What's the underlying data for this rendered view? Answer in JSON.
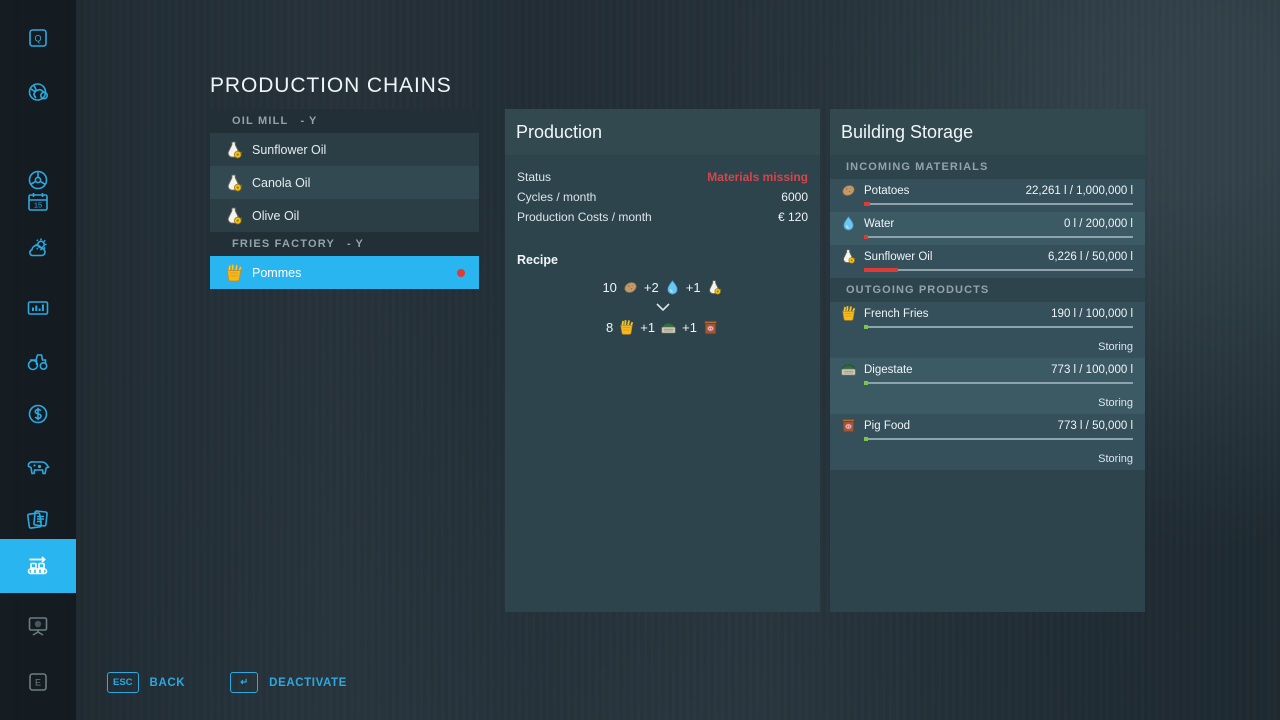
{
  "page_title": "PRODUCTION CHAINS",
  "sidebar": {
    "items": [
      {
        "name": "quick-menu",
        "icon": "q-key-icon",
        "active": false,
        "dim": false
      },
      {
        "name": "map",
        "icon": "globe-icon",
        "active": false,
        "dim": false
      },
      {
        "name": "vehicles-steering",
        "icon": "steering-wheel-icon",
        "active": false,
        "dim": false
      },
      {
        "name": "calendar",
        "icon": "calendar-15-icon",
        "active": false,
        "dim": false
      },
      {
        "name": "weather",
        "icon": "sun-cloud-icon",
        "active": false,
        "dim": false
      },
      {
        "name": "statistics",
        "icon": "bar-chart-icon",
        "active": false,
        "dim": false
      },
      {
        "name": "vehicles",
        "icon": "tractor-icon",
        "active": false,
        "dim": false
      },
      {
        "name": "finances",
        "icon": "dollar-circle-icon",
        "active": false,
        "dim": false
      },
      {
        "name": "animals",
        "icon": "cow-icon",
        "active": false,
        "dim": false
      },
      {
        "name": "contracts",
        "icon": "documents-icon",
        "active": false,
        "dim": false
      },
      {
        "name": "production",
        "icon": "conveyor-belt-icon",
        "active": true,
        "dim": false
      },
      {
        "name": "gallery",
        "icon": "easel-icon",
        "active": false,
        "dim": true
      },
      {
        "name": "exit",
        "icon": "e-key-icon",
        "active": false,
        "dim": true
      }
    ],
    "calendar_day": "15",
    "quick_key": "Q",
    "exit_key": "E"
  },
  "chains": {
    "groups": [
      {
        "header": "OIL MILL",
        "hotkey": "-  Y",
        "items": [
          {
            "label": "Sunflower Oil",
            "icon": "oil-bottle-icon",
            "selected": false,
            "status_dot": null
          },
          {
            "label": "Canola Oil",
            "icon": "oil-bottle-icon",
            "selected": false,
            "status_dot": null
          },
          {
            "label": "Olive Oil",
            "icon": "oil-bottle-icon",
            "selected": false,
            "status_dot": null
          }
        ]
      },
      {
        "header": "FRIES FACTORY",
        "hotkey": "-  Y",
        "items": [
          {
            "label": "Pommes",
            "icon": "fries-icon",
            "selected": true,
            "status_dot": "#e03a36"
          }
        ]
      }
    ]
  },
  "production": {
    "title": "Production",
    "stats": [
      {
        "label": "Status",
        "value": "Materials missing",
        "danger": true
      },
      {
        "label": "Cycles / month",
        "value": "6000",
        "danger": false
      },
      {
        "label": "Production Costs / month",
        "value": "€ 120",
        "danger": false
      }
    ],
    "recipe_title": "Recipe",
    "recipe": {
      "inputs": [
        {
          "amount": "10",
          "icon": "potato-icon"
        },
        {
          "amount": "+2",
          "icon": "water-drop-icon"
        },
        {
          "amount": "+1",
          "icon": "oil-bottle-icon"
        }
      ],
      "outputs": [
        {
          "amount": "8",
          "icon": "fries-icon"
        },
        {
          "amount": "+1",
          "icon": "digestate-icon"
        },
        {
          "amount": "+1",
          "icon": "pig-food-icon"
        }
      ]
    }
  },
  "storage": {
    "title": "Building Storage",
    "groups": [
      {
        "header": "INCOMING MATERIALS",
        "rows": [
          {
            "name": "Potatoes",
            "icon": "potato-icon",
            "amount": "22,261 l / 1,000,000 l",
            "fill_pct": 2.2,
            "bar_color": "red",
            "sub": null
          },
          {
            "name": "Water",
            "icon": "water-drop-icon",
            "amount": "0 l / 200,000 l",
            "fill_pct": 1.6,
            "bar_color": "red",
            "sub": null
          },
          {
            "name": "Sunflower Oil",
            "icon": "oil-bottle-icon",
            "amount": "6,226 l / 50,000 l",
            "fill_pct": 12.5,
            "bar_color": "red",
            "sub": null
          }
        ]
      },
      {
        "header": "OUTGOING PRODUCTS",
        "rows": [
          {
            "name": "French Fries",
            "icon": "fries-icon",
            "amount": "190 l / 100,000 l",
            "fill_pct": 1.6,
            "bar_color": "green",
            "sub": "Storing"
          },
          {
            "name": "Digestate",
            "icon": "digestate-icon",
            "amount": "773 l / 100,000 l",
            "fill_pct": 1.6,
            "bar_color": "green",
            "sub": "Storing"
          },
          {
            "name": "Pig Food",
            "icon": "pig-food-icon",
            "amount": "773 l / 50,000 l",
            "fill_pct": 1.6,
            "bar_color": "green",
            "sub": "Storing"
          }
        ]
      }
    ]
  },
  "footer": {
    "back_key": "ESC",
    "back_label": "BACK",
    "action_key": "↵",
    "action_label": "DEACTIVATE"
  },
  "colors": {
    "accent": "#29b6f0",
    "danger": "#d9434a",
    "ok": "#7ac943",
    "panel": "#2d444c",
    "background": "#222e36"
  }
}
